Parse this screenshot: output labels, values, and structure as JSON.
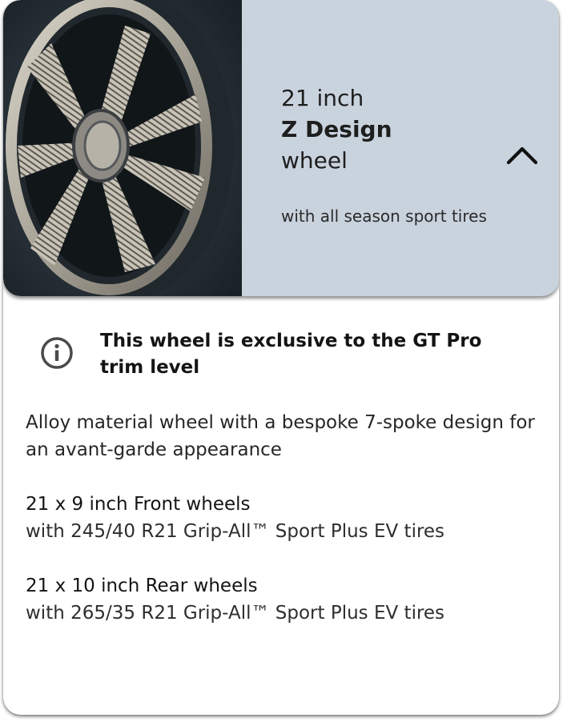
{
  "header": {
    "size_label": "21 inch",
    "name_label": "Z Design",
    "type_label": "wheel",
    "subtitle": "with all season sport tires",
    "toggle_icon": "chevron-up-icon",
    "background_color": "#c9d3de"
  },
  "wheel_image": {
    "icon": "wheel-photo"
  },
  "notice": {
    "icon": "info-circle-icon",
    "text": "This wheel is exclusive to the GT Pro trim level"
  },
  "description": "Alloy material wheel with a bespoke 7-spoke design for an avant-garde appearance",
  "specs": {
    "front": {
      "heading": "21 x 9 inch Front wheels",
      "detail": "with 245/40 R21 Grip-All™ Sport Plus EV tires"
    },
    "rear": {
      "heading": "21 x 10 inch Rear wheels",
      "detail": "with 265/35 R21 Grip-All™ Sport Plus EV tires"
    }
  }
}
